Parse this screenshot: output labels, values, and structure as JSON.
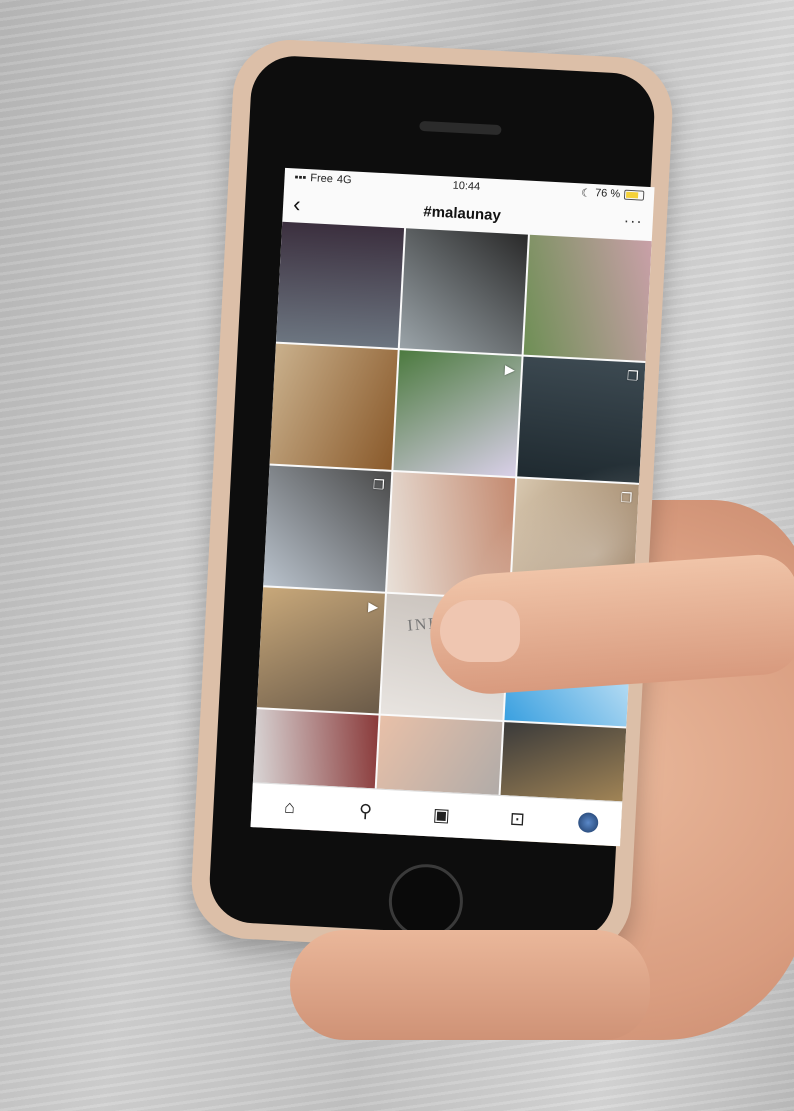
{
  "status_bar": {
    "carrier": "Free",
    "network": "4G",
    "time": "10:44",
    "battery_text": "76 %",
    "battery_level": 0.76
  },
  "header": {
    "back_icon": "chevron-left-icon",
    "title": "#malaunay",
    "more_icon": "more-dots-icon"
  },
  "grid": {
    "tiles": [
      {
        "name": "tile-person",
        "colors": [
          "#6c7580",
          "#3b2f3e"
        ]
      },
      {
        "name": "tile-food-truck",
        "colors": [
          "#9aa3a8",
          "#2a2a2a"
        ]
      },
      {
        "name": "tile-garden",
        "colors": [
          "#6e8f55",
          "#c9a0a8"
        ]
      },
      {
        "name": "tile-man-hat",
        "colors": [
          "#c9b08c",
          "#8a5a2b"
        ]
      },
      {
        "name": "tile-greenhouse-video",
        "colors": [
          "#4c7a3f",
          "#d9d0e8"
        ],
        "badge": "play-icon"
      },
      {
        "name": "tile-dark-poster",
        "colors": [
          "#1f2a30",
          "#3d4a52"
        ],
        "badge": "carousel-icon"
      },
      {
        "name": "tile-eiffel-tower",
        "colors": [
          "#b9c2cc",
          "#4a4a4a"
        ],
        "badge": "carousel-icon"
      },
      {
        "name": "tile-dancers",
        "colors": [
          "#e8e0d8",
          "#c48a70"
        ]
      },
      {
        "name": "tile-workshop",
        "colors": [
          "#d8c8b0",
          "#8a6a48"
        ],
        "badge": "carousel-icon"
      },
      {
        "name": "tile-wood-video",
        "colors": [
          "#c8a87a",
          "#6a5a48"
        ],
        "badge": "play-icon"
      },
      {
        "name": "tile-indigo",
        "colors": [
          "#e8e4e0",
          "#c9c2bc"
        ],
        "text": "INDIGO"
      },
      {
        "name": "tile-blue",
        "colors": [
          "#3aa0e0",
          "#e8f4fb"
        ]
      },
      {
        "name": "tile-snow",
        "colors": [
          "#dcdcdc",
          "#8a3a3a"
        ]
      },
      {
        "name": "tile-hands",
        "colors": [
          "#e8c0a8",
          "#a8a8a8"
        ]
      },
      {
        "name": "tile-cafe",
        "colors": [
          "#3a3a3a",
          "#c8a060"
        ]
      }
    ]
  },
  "tab_bar": {
    "items": [
      "home-icon",
      "search-icon",
      "reels-icon",
      "shop-icon",
      "profile-avatar-icon"
    ]
  }
}
